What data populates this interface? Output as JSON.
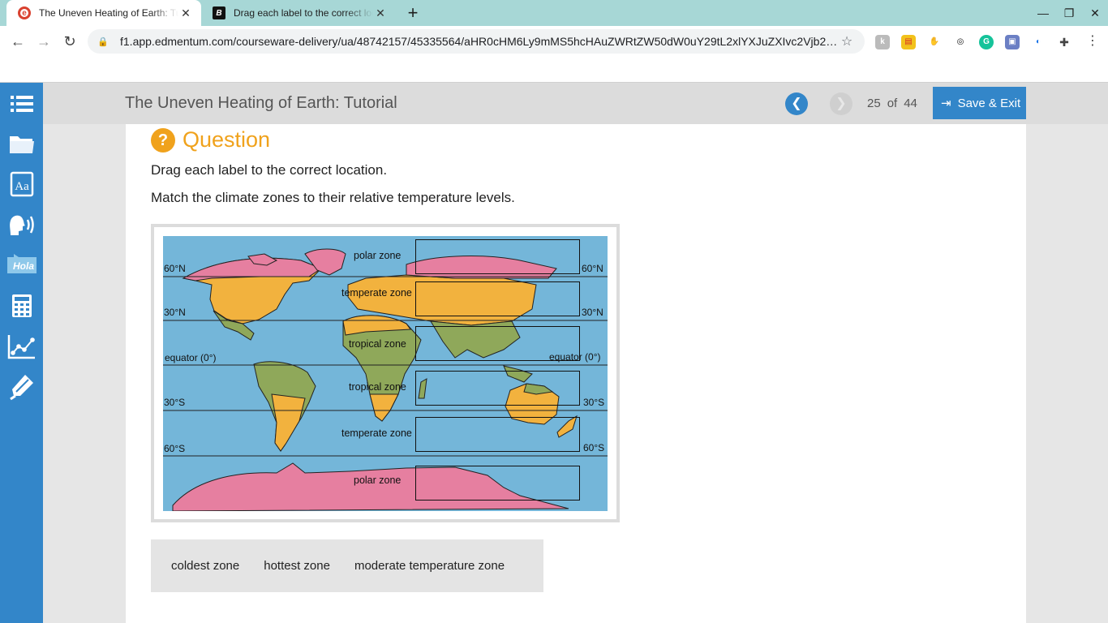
{
  "browser": {
    "tabs": [
      {
        "title": "The Uneven Heating of Earth: Tutorial",
        "active": true
      },
      {
        "title": "Drag each label to the correct location.",
        "active": false
      }
    ],
    "url": "f1.app.edmentum.com/courseware-delivery/ua/48742157/45335564/aHR0cHM6Ly9mMS5hcHAuZWRtZW50dW0uY29tL2xlYXJuZXIvc2Vjb25kYXJ5L3Zjb..."
  },
  "header": {
    "title": "The Uneven Heating of Earth: Tutorial",
    "page_current": "25",
    "page_of": "of",
    "page_total": "44",
    "save_exit": "Save & Exit"
  },
  "question": {
    "heading": "Question",
    "icon_glyph": "?",
    "instruction_1": "Drag each label to the correct location.",
    "instruction_2": "Match the climate zones to their relative temperature levels."
  },
  "map": {
    "latitudes": {
      "n60": "60°N",
      "n30": "30°N",
      "equator": "equator (0°)",
      "s30": "30°S",
      "s60": "60°S"
    },
    "zones": {
      "polar_north": "polar zone",
      "temperate_north": "temperate zone",
      "tropical_north": "tropical zone",
      "tropical_south": "tropical zone",
      "temperate_south": "temperate zone",
      "polar_south": "polar zone"
    },
    "colors": {
      "ocean": "#74b6d9",
      "polar": "#e67fa0",
      "temperate": "#f2b23e",
      "tropical": "#8fa85a"
    }
  },
  "labels": [
    "coldest zone",
    "hottest zone",
    "moderate temperature zone"
  ],
  "icons": {
    "rail": [
      "list-icon",
      "folder-icon",
      "dictionary-icon",
      "text-to-speech-icon",
      "translate-icon",
      "calculator-icon",
      "graph-icon",
      "highlighter-icon"
    ]
  }
}
